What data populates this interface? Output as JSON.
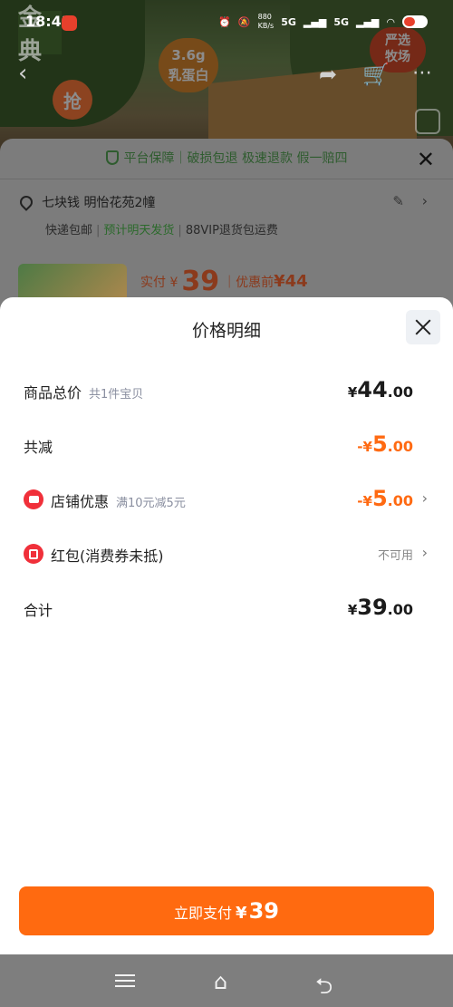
{
  "status_bar": {
    "time": "18:43",
    "net_speed": "880\nKB/s",
    "signal1": "5G",
    "signal2": "5G",
    "battery": "48"
  },
  "background": {
    "logo_text": "金典",
    "grab_text": "抢",
    "protein_text": "3.6g\n乳蛋白",
    "badge_text": "严选\n牧场",
    "guarantee": "平台保障｜破损包退 极速退款 假一赔四",
    "address": "七块钱 明怡花苑2幢",
    "shipping_parts": [
      "快递包邮",
      "预计明天发货",
      "88VIP退货包运费"
    ],
    "paid_prefix": "实付 ¥",
    "paid_amount": "39",
    "paid_pre_label": "优惠前",
    "paid_pre_amount": "¥44"
  },
  "modal": {
    "title": "价格明细",
    "rows": {
      "total": {
        "label": "商品总价",
        "sub": "共1件宝贝",
        "yen": "¥",
        "int": "44",
        "dec": ".00"
      },
      "discount": {
        "label": "共减",
        "yen": "-¥",
        "int": "5",
        "dec": ".00"
      },
      "shop": {
        "label": "店铺优惠",
        "sub": "满10元减5元",
        "yen": "-¥",
        "int": "5",
        "dec": ".00"
      },
      "redpacket": {
        "label": "红包(消费券未抵)",
        "status": "不可用"
      },
      "sum": {
        "label": "合计",
        "yen": "¥",
        "int": "39",
        "dec": ".00"
      }
    },
    "pay_button": {
      "text": "立即支付",
      "yen": "¥",
      "amount": "39"
    }
  },
  "colors": {
    "accent": "#ff6a10",
    "discount": "#ff6a12",
    "icon_red": "#f0303a"
  }
}
